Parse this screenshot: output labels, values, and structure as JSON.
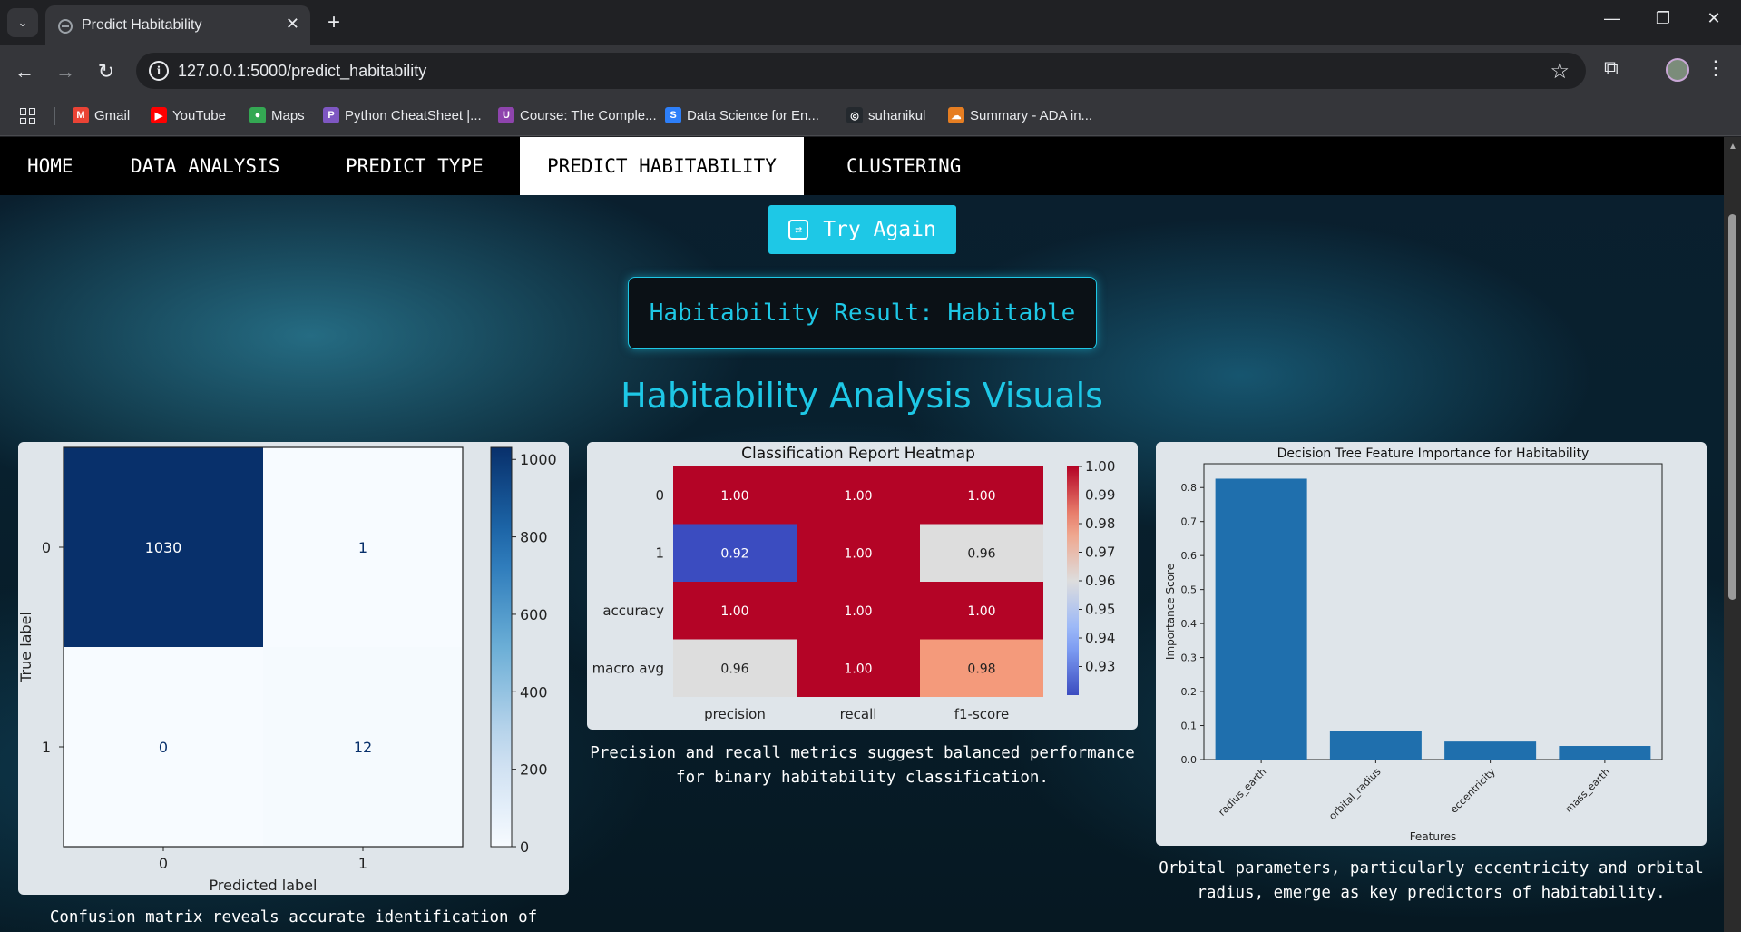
{
  "browser": {
    "tab_title": "Predict Habitability",
    "url": "127.0.0.1:5000/predict_habitability",
    "bookmarks": [
      {
        "label": "Gmail",
        "color": "#ea4335",
        "glyph": "M"
      },
      {
        "label": "YouTube",
        "color": "#ff0000",
        "glyph": "▶"
      },
      {
        "label": "Maps",
        "color": "#34a853",
        "glyph": "●"
      },
      {
        "label": "Python CheatSheet |...",
        "color": "#7e57c2",
        "glyph": "P"
      },
      {
        "label": "Course: The Comple...",
        "color": "#8e44ad",
        "glyph": "U"
      },
      {
        "label": "Data Science for En...",
        "color": "#2d7ff9",
        "glyph": "S"
      },
      {
        "label": "suhanikul",
        "color": "#24292e",
        "glyph": "◎"
      },
      {
        "label": "Summary - ADA in...",
        "color": "#e67e22",
        "glyph": "☁"
      }
    ]
  },
  "nav": {
    "items": [
      "HOME",
      "DATA ANALYSIS",
      "PREDICT TYPE",
      "PREDICT HABITABILITY",
      "CLUSTERING"
    ],
    "active": "PREDICT HABITABILITY"
  },
  "page": {
    "try_again": "Try Again",
    "result": "Habitability Result: Habitable",
    "section_title": "Habitability Analysis Visuals",
    "captions": {
      "confusion": "Confusion matrix reveals accurate identification of",
      "heatmap": "Precision and recall metrics suggest balanced performance for binary habitability classification.",
      "importance": "Orbital parameters, particularly eccentricity and orbital radius, emerge as key predictors of habitability."
    }
  },
  "chart_data": [
    {
      "type": "heatmap",
      "title": "",
      "xlabel": "Predicted label",
      "ylabel": "True label",
      "x_categories": [
        "0",
        "1"
      ],
      "y_categories": [
        "0",
        "1"
      ],
      "values": [
        [
          1030,
          1
        ],
        [
          0,
          12
        ]
      ],
      "colorbar_ticks": [
        0,
        200,
        400,
        600,
        800,
        1000
      ],
      "colormap": "Blues"
    },
    {
      "type": "heatmap",
      "title": "Classification Report Heatmap",
      "x_categories": [
        "precision",
        "recall",
        "f1-score"
      ],
      "y_categories": [
        "0",
        "1",
        "accuracy",
        "macro avg"
      ],
      "values": [
        [
          1.0,
          1.0,
          1.0
        ],
        [
          0.92,
          1.0,
          0.96
        ],
        [
          1.0,
          1.0,
          1.0
        ],
        [
          0.96,
          1.0,
          0.98
        ]
      ],
      "colorbar_ticks": [
        0.93,
        0.94,
        0.95,
        0.96,
        0.97,
        0.98,
        0.99,
        1.0
      ],
      "colormap": "coolwarm"
    },
    {
      "type": "bar",
      "title": "Decision Tree Feature Importance for Habitability",
      "xlabel": "Features",
      "ylabel": "Importance Score",
      "categories": [
        "radius_earth",
        "orbital_radius",
        "eccentricity",
        "mass_earth"
      ],
      "values": [
        0.826,
        0.085,
        0.053,
        0.04
      ],
      "ylim": [
        0,
        0.87
      ],
      "yticks": [
        0.0,
        0.1,
        0.2,
        0.3,
        0.4,
        0.5,
        0.6,
        0.7,
        0.8
      ],
      "color": "#1f6fad"
    }
  ]
}
